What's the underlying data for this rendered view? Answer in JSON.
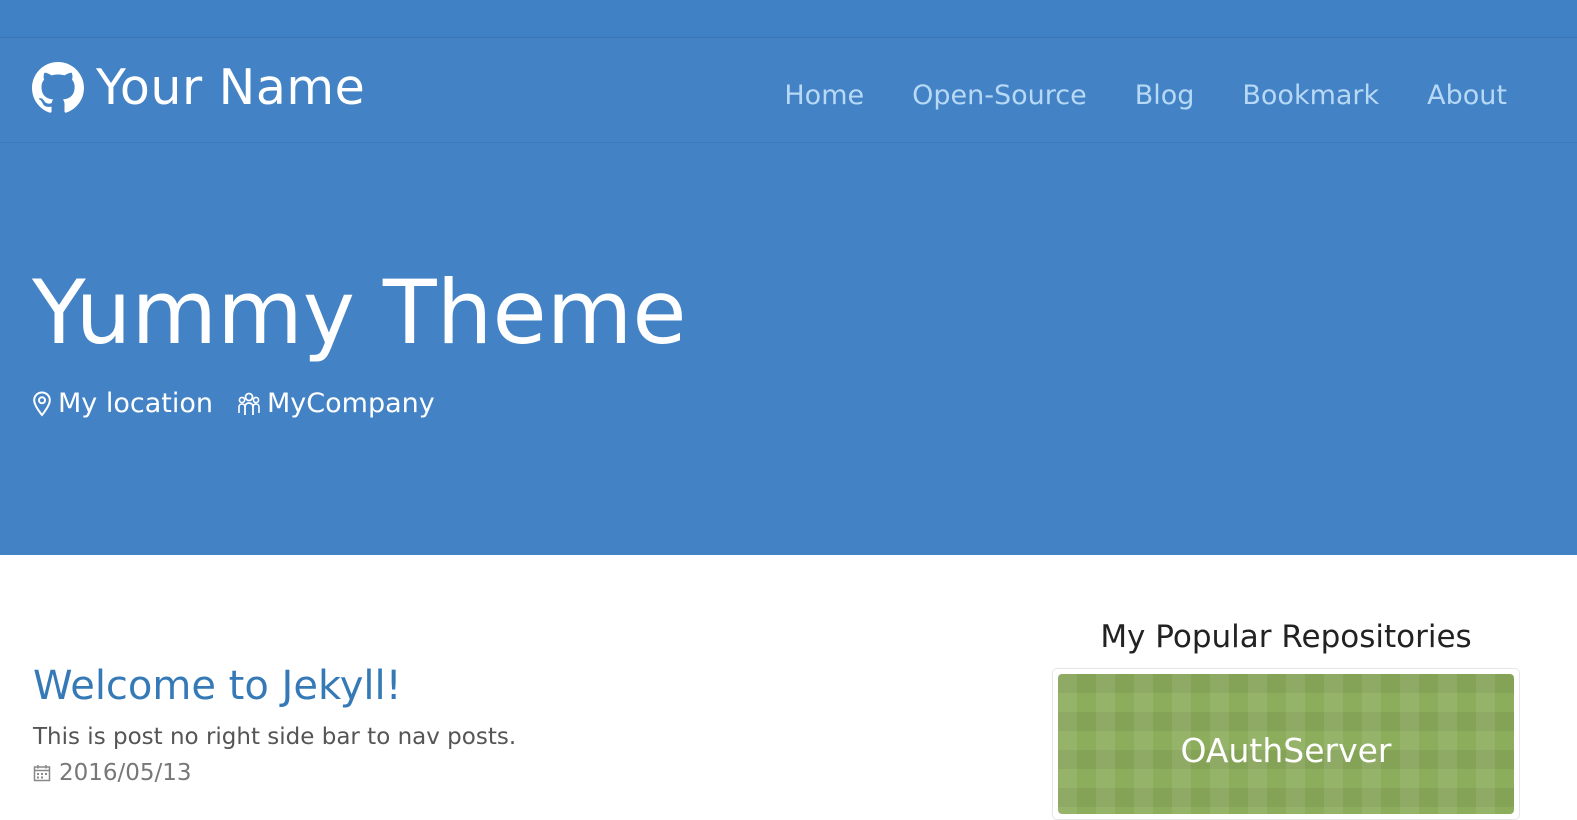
{
  "header": {
    "brand_name": "Your Name",
    "brand_icon": "github-icon"
  },
  "nav": {
    "items": [
      {
        "label": "Home"
      },
      {
        "label": "Open-Source"
      },
      {
        "label": "Blog"
      },
      {
        "label": "Bookmark"
      },
      {
        "label": "About"
      }
    ]
  },
  "hero": {
    "title": "Yummy Theme",
    "location": "My location",
    "location_icon": "map-pin-icon",
    "company": "MyCompany",
    "company_icon": "people-icon"
  },
  "post": {
    "title": "Welcome to Jekyll!",
    "excerpt": "This is post no right side bar to nav posts.",
    "date": "2016/05/13",
    "date_icon": "calendar-icon"
  },
  "sidebar": {
    "title": "My Popular Repositories",
    "repos": [
      {
        "name": "OAuthServer"
      }
    ]
  },
  "colors": {
    "header_bg": "#4282c5",
    "nav_link": "#b7d9f6",
    "post_link": "#357ab7",
    "repo_banner": "#8cad5c"
  }
}
